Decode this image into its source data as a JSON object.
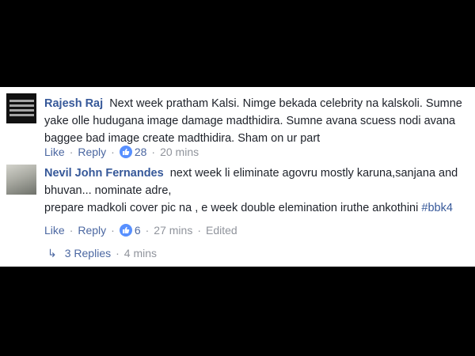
{
  "comments": [
    {
      "author": "Rajesh Raj",
      "text_lines": [
        "Next week pratham Kalsi. Nimge bekada celebrity na kalskoli. Sumne",
        "yake olle hudugana image damage madthidira. Sumne avana scuess nodi avana",
        "baggee bad image create madthidira. Sham on ur part"
      ],
      "like_label": "Like",
      "reply_label": "Reply",
      "reaction_icon": "thumbs-up-icon",
      "reaction_count": "28",
      "time": "20 mins"
    },
    {
      "author": "Nevil John Fernandes",
      "text_lines": [
        "next week li eliminate agovru mostly karuna,sanjana and",
        "bhuvan... nominate adre,",
        "prepare madkoli cover pic na , e week double elemination iruthe ankothini "
      ],
      "hashtag": "#bbk4",
      "like_label": "Like",
      "reply_label": "Reply",
      "reaction_icon": "thumbs-up-icon",
      "reaction_count": "6",
      "time": "27 mins",
      "edited_label": "Edited",
      "replies": {
        "icon": "reply-arrow-icon",
        "label": "3 Replies",
        "time": "4 mins"
      }
    }
  ],
  "colors": {
    "link": "#365899",
    "text": "#1d2129",
    "meta": "#90949c",
    "reaction": "#5890ff"
  }
}
